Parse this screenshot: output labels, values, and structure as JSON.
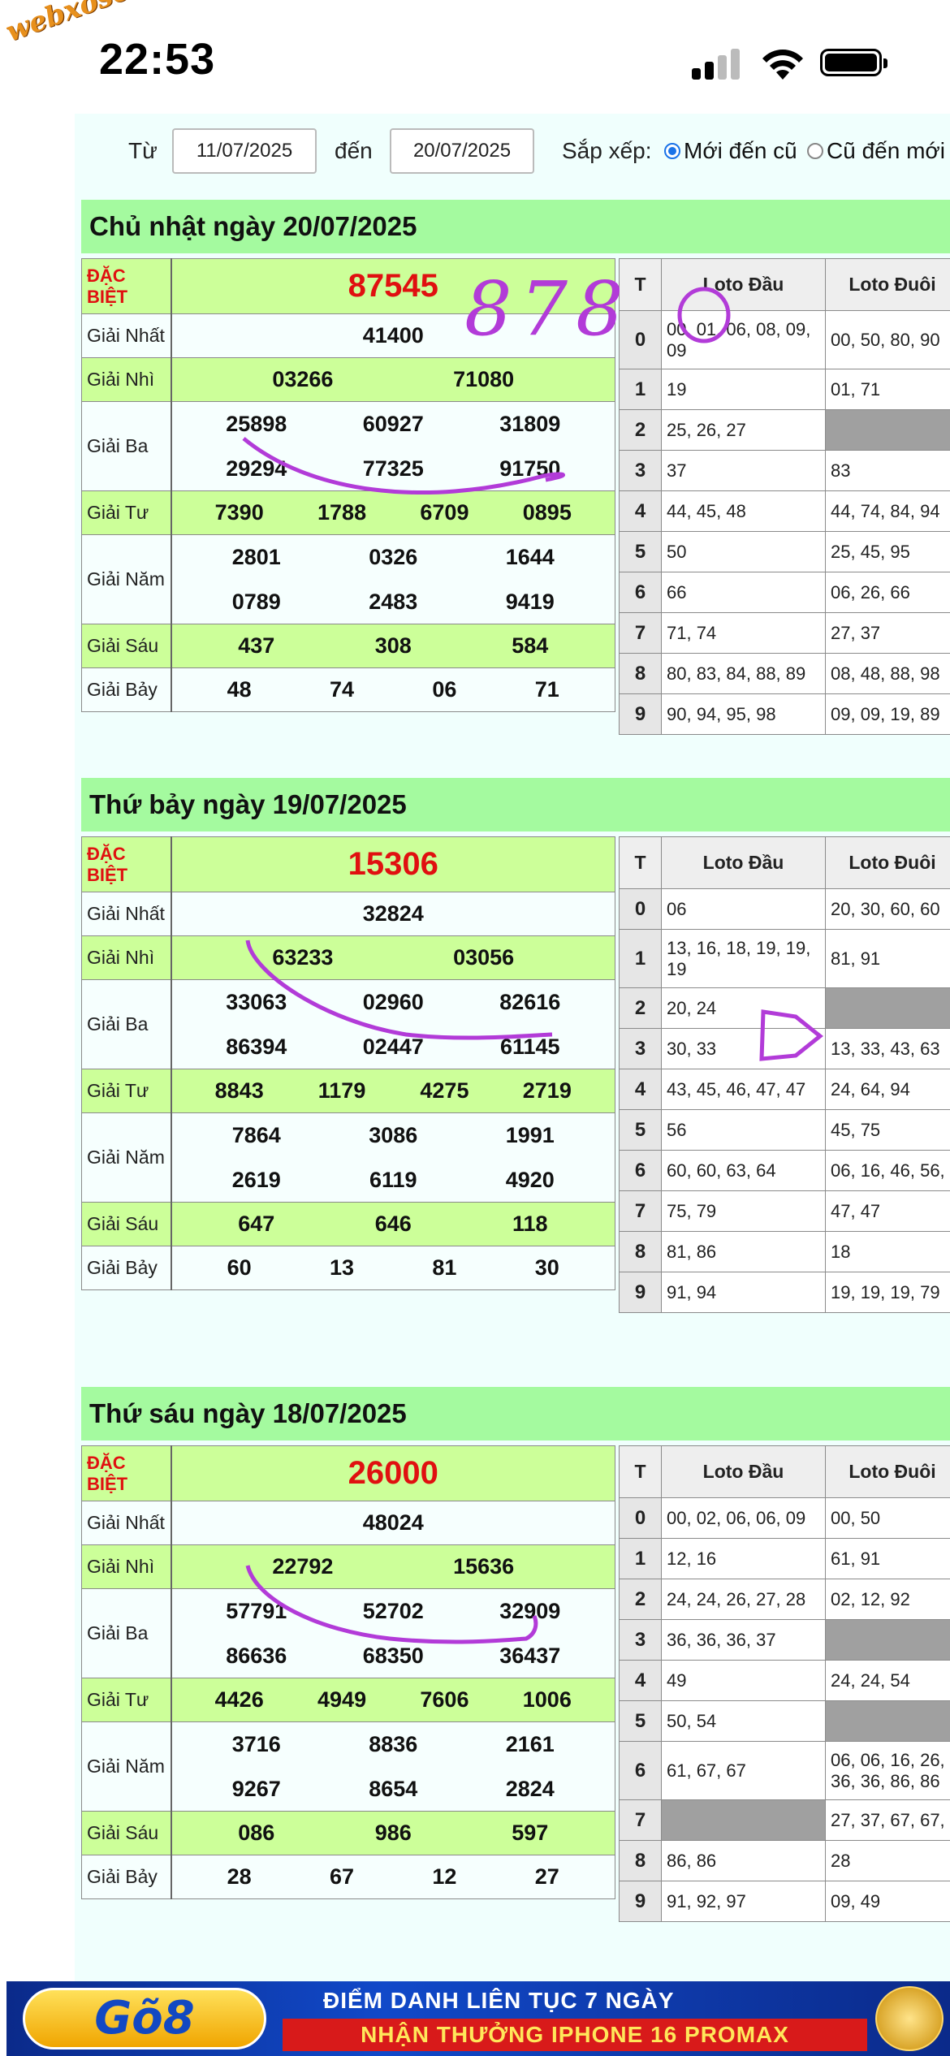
{
  "status_bar": {
    "watermark": "webxoso.net",
    "time": "22:53"
  },
  "filter": {
    "from_label": "Từ",
    "from_value": "11/07/2025",
    "to_label": "đến",
    "to_value": "20/07/2025",
    "sort_label": "Sắp xếp:",
    "opt_new": "Mới đến cũ",
    "opt_old": "Cũ đến mới"
  },
  "headers": {
    "t": "T",
    "dau": "Loto Đầu",
    "duoi": "Loto Đuôi"
  },
  "prize_names": {
    "db1": "ĐẶC",
    "db2": "BIỆT",
    "nhat": "Giải Nhất",
    "nhi": "Giải Nhì",
    "ba": "Giải Ba",
    "tu": "Giải Tư",
    "nam": "Giải Năm",
    "sau": "Giải Sáu",
    "bay": "Giải Bảy"
  },
  "draws": [
    {
      "title": "Chủ nhật ngày 20/07/2025",
      "special": "87545",
      "nhat": "41400",
      "nhi": [
        "03266",
        "71080"
      ],
      "ba": [
        [
          "25898",
          "60927",
          "31809"
        ],
        [
          "29294",
          "77325",
          "91750"
        ]
      ],
      "tu": [
        "7390",
        "1788",
        "6709",
        "0895"
      ],
      "nam": [
        [
          "2801",
          "0326",
          "1644"
        ],
        [
          "0789",
          "2483",
          "9419"
        ]
      ],
      "sau": [
        "437",
        "308",
        "584"
      ],
      "bay": [
        "48",
        "74",
        "06",
        "71"
      ],
      "loto": [
        {
          "t": "0",
          "dau": "00, 01, 06, 08, 09, 09",
          "duoi": "00, 50, 80, 90"
        },
        {
          "t": "1",
          "dau": "19",
          "duoi": "01, 71"
        },
        {
          "t": "2",
          "dau": "25, 26, 27",
          "duoi": ""
        },
        {
          "t": "3",
          "dau": "37",
          "duoi": "83"
        },
        {
          "t": "4",
          "dau": "44, 45, 48",
          "duoi": "44, 74, 84, 94"
        },
        {
          "t": "5",
          "dau": "50",
          "duoi": "25, 45, 95"
        },
        {
          "t": "6",
          "dau": "66",
          "duoi": "06, 26, 66"
        },
        {
          "t": "7",
          "dau": "71, 74",
          "duoi": "27, 37"
        },
        {
          "t": "8",
          "dau": "80, 83, 84, 88, 89",
          "duoi": "08, 48, 88, 98"
        },
        {
          "t": "9",
          "dau": "90, 94, 95, 98",
          "duoi": "09, 09, 19, 89"
        }
      ],
      "handwriting": "878"
    },
    {
      "title": "Thứ bảy ngày 19/07/2025",
      "special": "15306",
      "nhat": "32824",
      "nhi": [
        "63233",
        "03056"
      ],
      "ba": [
        [
          "33063",
          "02960",
          "82616"
        ],
        [
          "86394",
          "02447",
          "61145"
        ]
      ],
      "tu": [
        "8843",
        "1179",
        "4275",
        "2719"
      ],
      "nam": [
        [
          "7864",
          "3086",
          "1991"
        ],
        [
          "2619",
          "6119",
          "4920"
        ]
      ],
      "sau": [
        "647",
        "646",
        "118"
      ],
      "bay": [
        "60",
        "13",
        "81",
        "30"
      ],
      "loto": [
        {
          "t": "0",
          "dau": "06",
          "duoi": "20, 30, 60, 60"
        },
        {
          "t": "1",
          "dau": "13, 16, 18, 19, 19, 19",
          "duoi": "81, 91"
        },
        {
          "t": "2",
          "dau": "20, 24",
          "duoi": ""
        },
        {
          "t": "3",
          "dau": "30, 33",
          "duoi": "13, 33, 43, 63"
        },
        {
          "t": "4",
          "dau": "43, 45, 46, 47, 47",
          "duoi": "24, 64, 94"
        },
        {
          "t": "5",
          "dau": "56",
          "duoi": "45, 75"
        },
        {
          "t": "6",
          "dau": "60, 60, 63, 64",
          "duoi": "06, 16, 46, 56,"
        },
        {
          "t": "7",
          "dau": "75, 79",
          "duoi": "47, 47"
        },
        {
          "t": "8",
          "dau": "81, 86",
          "duoi": "18"
        },
        {
          "t": "9",
          "dau": "91, 94",
          "duoi": "19, 19, 19, 79"
        }
      ]
    },
    {
      "title": "Thứ sáu ngày 18/07/2025",
      "special": "26000",
      "nhat": "48024",
      "nhi": [
        "22792",
        "15636"
      ],
      "ba": [
        [
          "57791",
          "52702",
          "32909"
        ],
        [
          "86636",
          "68350",
          "36437"
        ]
      ],
      "tu": [
        "4426",
        "4949",
        "7606",
        "1006"
      ],
      "nam": [
        [
          "3716",
          "8836",
          "2161"
        ],
        [
          "9267",
          "8654",
          "2824"
        ]
      ],
      "sau": [
        "086",
        "986",
        "597"
      ],
      "bay": [
        "28",
        "67",
        "12",
        "27"
      ],
      "loto": [
        {
          "t": "0",
          "dau": "00, 02, 06, 06, 09",
          "duoi": "00, 50"
        },
        {
          "t": "1",
          "dau": "12, 16",
          "duoi": "61, 91"
        },
        {
          "t": "2",
          "dau": "24, 24, 26, 27, 28",
          "duoi": "02, 12, 92"
        },
        {
          "t": "3",
          "dau": "36, 36, 36, 37",
          "duoi": ""
        },
        {
          "t": "4",
          "dau": "49",
          "duoi": "24, 24, 54"
        },
        {
          "t": "5",
          "dau": "50, 54",
          "duoi": ""
        },
        {
          "t": "6",
          "dau": "61, 67, 67",
          "duoi": "06, 06, 16, 26, 36, 36, 86, 86"
        },
        {
          "t": "7",
          "dau": "",
          "duoi": "27, 37, 67, 67,"
        },
        {
          "t": "8",
          "dau": "86, 86",
          "duoi": "28"
        },
        {
          "t": "9",
          "dau": "91, 92, 97",
          "duoi": "09, 49"
        }
      ]
    }
  ],
  "banner": {
    "logo": "Gõ8",
    "line1": "ĐIỂM DANH LIÊN TỤC 7 NGÀY",
    "line2": "NHẬN THƯỞNG IPHONE 16 PROMAX"
  },
  "colors": {
    "section_header": "#a4fa9f",
    "row_green": "#ccff99",
    "special": "#e01010",
    "ink": "#b23bd8"
  }
}
